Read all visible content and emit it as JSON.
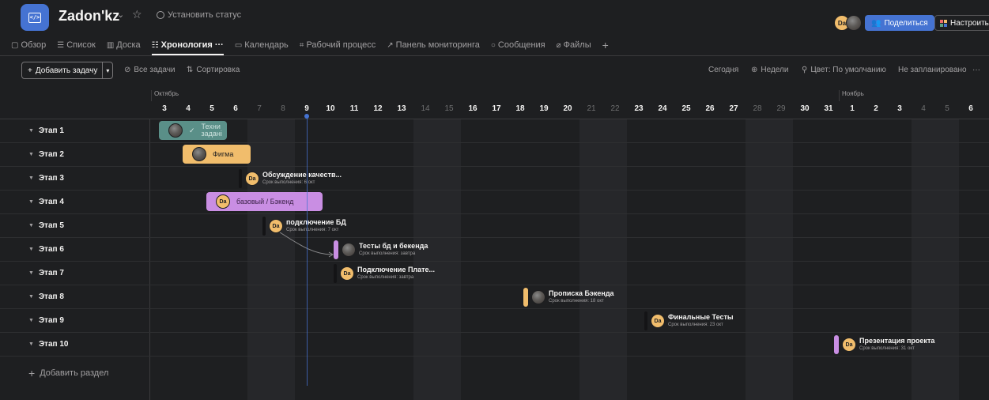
{
  "project": {
    "title": "Zadon'kz",
    "status_label": "Установить статус",
    "icon": "code-icon"
  },
  "header": {
    "share_label": "Поделиться",
    "customize_label": "Настроить",
    "avatar_initials": "Da"
  },
  "tabs": [
    {
      "label": "Обзор",
      "icon": "overview-icon"
    },
    {
      "label": "Список",
      "icon": "list-icon"
    },
    {
      "label": "Доска",
      "icon": "board-icon"
    },
    {
      "label": "Хронология",
      "icon": "timeline-icon",
      "active": true,
      "more": "···"
    },
    {
      "label": "Календарь",
      "icon": "calendar-icon"
    },
    {
      "label": "Рабочий процесс",
      "icon": "workflow-icon"
    },
    {
      "label": "Панель мониторинга",
      "icon": "dashboard-icon"
    },
    {
      "label": "Сообщения",
      "icon": "messages-icon"
    },
    {
      "label": "Файлы",
      "icon": "files-icon"
    }
  ],
  "toolbar": {
    "add_task": "Добавить задачу",
    "all_tasks": "Все задачи",
    "sort": "Сортировка",
    "today": "Сегодня",
    "weeks": "Недели",
    "color": "Цвет: По умолчанию",
    "unscheduled": "Не запланировано",
    "more": "···"
  },
  "timeline": {
    "months": [
      "Октябрь",
      "Ноябрь"
    ],
    "days": [
      "3",
      "4",
      "5",
      "6",
      "7",
      "8",
      "9",
      "10",
      "11",
      "12",
      "13",
      "14",
      "15",
      "16",
      "17",
      "18",
      "19",
      "20",
      "21",
      "22",
      "23",
      "24",
      "25",
      "26",
      "27",
      "28",
      "29",
      "30",
      "31",
      "1",
      "2",
      "3",
      "4",
      "5",
      "6"
    ],
    "today": "9"
  },
  "sections": [
    {
      "label": "Этап 1"
    },
    {
      "label": "Этап 2"
    },
    {
      "label": "Этап 3"
    },
    {
      "label": "Этап 4"
    },
    {
      "label": "Этап 5"
    },
    {
      "label": "Этап 6"
    },
    {
      "label": "Этап 7"
    },
    {
      "label": "Этап 8"
    },
    {
      "label": "Этап 9"
    },
    {
      "label": "Этап 10"
    }
  ],
  "add_section": "Добавить раздел",
  "tasks": {
    "t1": {
      "name": "Техни задані",
      "check": "✓"
    },
    "t2": {
      "name": "Фигма"
    },
    "t3": {
      "name": "Обсуждение качеств...",
      "due": "Срок выполнения: 6 окт"
    },
    "t4": {
      "name": "базовый / Бэкенд"
    },
    "t5": {
      "name": "подключение БД",
      "due": "Срок выполнения: 7 окт"
    },
    "t6": {
      "name": "Тесты бд и бекенда",
      "due": "Срок выполнения: завтра"
    },
    "t7": {
      "name": "Подключение Плате...",
      "due": "Срок выполнения: завтра"
    },
    "t8": {
      "name": "Прописка Бэкенда",
      "due": "Срок выполнения: 18 окт"
    },
    "t9": {
      "name": "Финальные Тесты",
      "due": "Срок выполнения: 23 окт"
    },
    "t10": {
      "name": "Презентация проекта",
      "due": "Срок выполнения: 31 окт"
    }
  },
  "colors": {
    "accent": "#4573d2",
    "teal": "#5a8f88",
    "orange": "#f1bd6c",
    "purple": "#c98ee3",
    "avatar": "#f1bd6c"
  }
}
